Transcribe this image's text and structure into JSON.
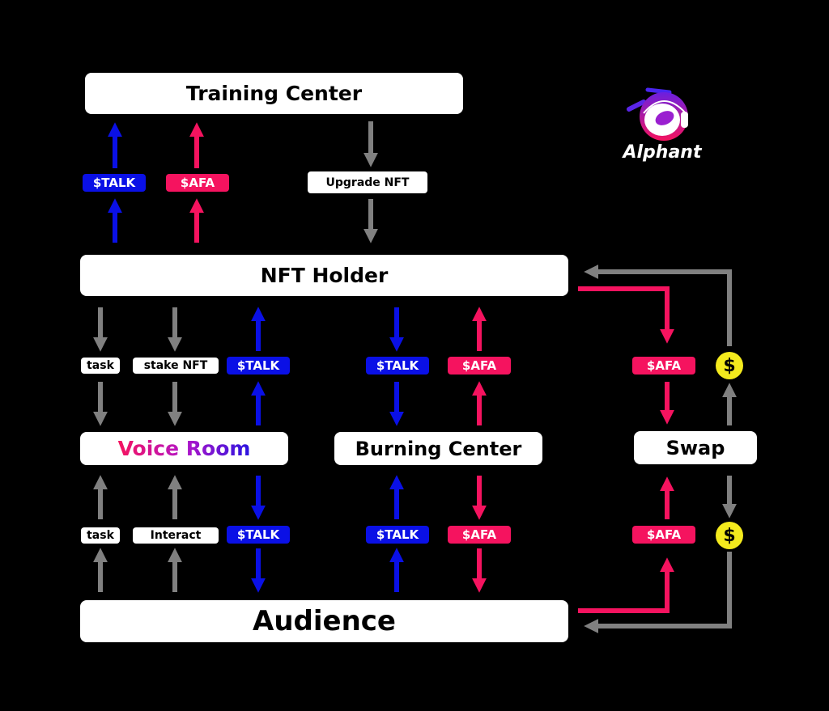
{
  "brand": {
    "name": "Alphant",
    "logo_icon": "alphant-headphones-logo"
  },
  "colors": {
    "talk": "#0a10e6",
    "afa": "#f5135f",
    "neutral": "#808080",
    "coin": "#f4ea1d",
    "box": "#ffffff",
    "background": "#000000"
  },
  "nodes": {
    "training_center": "Training Center",
    "nft_holder": "NFT Holder",
    "voice_room": "Voice Room",
    "burning_center": "Burning Center",
    "swap": "Swap",
    "audience": "Audience"
  },
  "labels": {
    "training_talk": "$TALK",
    "training_afa": "$AFA",
    "upgrade_nft": "Upgrade NFT",
    "holder_task": "task",
    "holder_stake": "stake NFT",
    "holder_talk": "$TALK",
    "burn_top_talk": "$TALK",
    "burn_top_afa": "$AFA",
    "swap_top_afa": "$AFA",
    "coin_top": "$",
    "aud_task": "task",
    "aud_interact": "Interact",
    "aud_talk": "$TALK",
    "burn_bot_talk": "$TALK",
    "burn_bot_afa": "$AFA",
    "swap_bot_afa": "$AFA",
    "coin_bot": "$"
  },
  "flows": [
    {
      "from": "NFT Holder",
      "to": "Training Center",
      "label": "$TALK",
      "color": "talk"
    },
    {
      "from": "NFT Holder",
      "to": "Training Center",
      "label": "$AFA",
      "color": "afa"
    },
    {
      "from": "Training Center",
      "to": "NFT Holder",
      "label": "Upgrade NFT",
      "color": "neutral"
    },
    {
      "from": "NFT Holder",
      "to": "Voice Room",
      "label": "task",
      "color": "neutral"
    },
    {
      "from": "NFT Holder",
      "to": "Voice Room",
      "label": "stake NFT",
      "color": "neutral"
    },
    {
      "from": "Voice Room",
      "to": "NFT Holder",
      "label": "$TALK",
      "color": "talk"
    },
    {
      "from": "NFT Holder",
      "to": "Burning Center",
      "label": "$TALK",
      "color": "talk"
    },
    {
      "from": "Burning Center",
      "to": "NFT Holder",
      "label": "$AFA",
      "color": "afa"
    },
    {
      "from": "NFT Holder",
      "to": "Swap",
      "label": "$AFA",
      "color": "afa"
    },
    {
      "from": "Swap",
      "to": "NFT Holder",
      "label": "$",
      "color": "neutral"
    },
    {
      "from": "Audience",
      "to": "Voice Room",
      "label": "task",
      "color": "neutral"
    },
    {
      "from": "Audience",
      "to": "Voice Room",
      "label": "Interact",
      "color": "neutral"
    },
    {
      "from": "Voice Room",
      "to": "Audience",
      "label": "$TALK",
      "color": "talk"
    },
    {
      "from": "Audience",
      "to": "Burning Center",
      "label": "$TALK",
      "color": "talk"
    },
    {
      "from": "Burning Center",
      "to": "Audience",
      "label": "$AFA",
      "color": "afa"
    },
    {
      "from": "Audience",
      "to": "Swap",
      "label": "$AFA",
      "color": "afa"
    },
    {
      "from": "Swap",
      "to": "Audience",
      "label": "$",
      "color": "neutral"
    }
  ]
}
